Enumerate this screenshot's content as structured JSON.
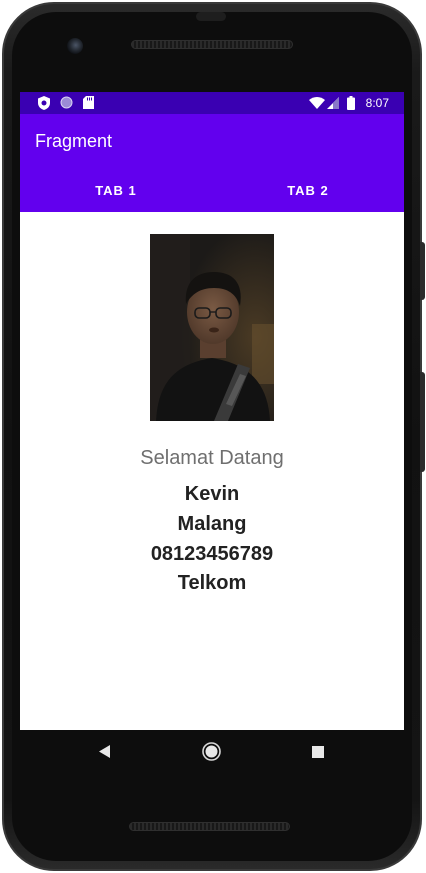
{
  "status_bar": {
    "time": "8:07",
    "icons": [
      "shield-icon",
      "circle-icon",
      "sd-card-icon",
      "wifi-icon",
      "signal-icon",
      "battery-icon"
    ]
  },
  "app_bar": {
    "title": "Fragment"
  },
  "tabs": [
    {
      "label": "TAB 1",
      "selected": true
    },
    {
      "label": "TAB 2",
      "selected": false
    }
  ],
  "profile": {
    "welcome": "Selamat Datang",
    "name": "Kevin",
    "city": "Malang",
    "phone": "08123456789",
    "company": "Telkom"
  },
  "nav_bar": {
    "icons": [
      "back-icon",
      "home-icon",
      "recents-icon"
    ]
  },
  "colors": {
    "primary": "#6200ee",
    "status_bar": "#3a00b2",
    "title_text": "#ffffff",
    "welcome_text": "#6f6f6f",
    "info_text": "#222222"
  }
}
